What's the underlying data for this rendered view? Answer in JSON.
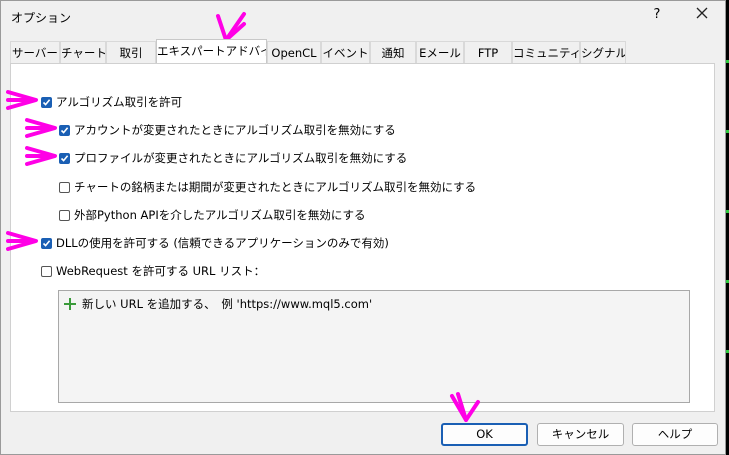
{
  "window": {
    "title": "オプション",
    "help_glyph": "?"
  },
  "tabs": [
    {
      "label": "サーバー",
      "active": false
    },
    {
      "label": "チャート",
      "active": false
    },
    {
      "label": "取引",
      "active": false
    },
    {
      "label": "エキスパートアドバイザ",
      "active": true
    },
    {
      "label": "OpenCL",
      "active": false
    },
    {
      "label": "イベント",
      "active": false
    },
    {
      "label": "通知",
      "active": false
    },
    {
      "label": "Eメール",
      "active": false
    },
    {
      "label": "FTP",
      "active": false
    },
    {
      "label": "コミュニティー",
      "active": false
    },
    {
      "label": "シグナル",
      "active": false
    }
  ],
  "options": [
    {
      "label": "アルゴリズム取引を許可",
      "checked": true
    },
    {
      "label": "アカウントが変更されたときにアルゴリズム取引を無効にする",
      "checked": true
    },
    {
      "label": "プロファイルが変更されたときにアルゴリズム取引を無効にする",
      "checked": true
    },
    {
      "label": "チャートの銘柄または期間が変更されたときにアルゴリズム取引を無効にする",
      "checked": false
    },
    {
      "label": "外部Python APIを介したアルゴリズム取引を無効にする",
      "checked": false
    },
    {
      "label": "DLLの使用を許可する (信頼できるアプリケーションのみで有効)",
      "checked": true
    },
    {
      "label": "WebRequest を許可する URL リスト：",
      "checked": false
    }
  ],
  "url_list": {
    "add_label": "新しい URL を追加する、　例 'https://www.mql5.com'"
  },
  "buttons": {
    "ok": "OK",
    "cancel": "キャンセル",
    "help": "ヘルプ"
  },
  "colors": {
    "checkbox_checked": "#1a5fb4",
    "annotation_arrow": "#ff00e6",
    "add_icon": "#3a9a3a"
  }
}
